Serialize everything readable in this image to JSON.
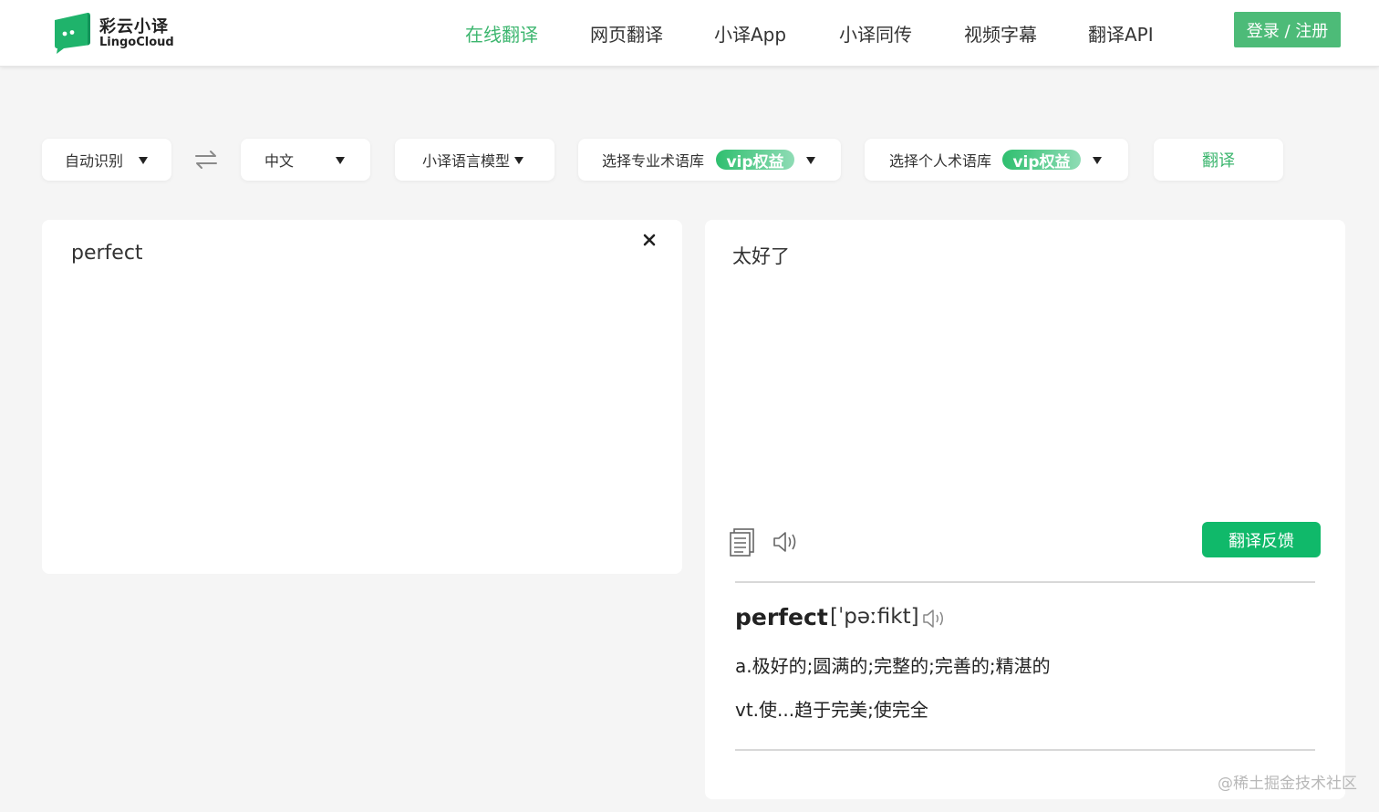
{
  "brand": {
    "title": "彩云小译",
    "subtitle": "LingoCloud",
    "accent": "#3db66f"
  },
  "nav": {
    "items": [
      {
        "label": "在线翻译",
        "active": true
      },
      {
        "label": "网页翻译",
        "active": false
      },
      {
        "label": "小译App",
        "active": false
      },
      {
        "label": "小译同传",
        "active": false
      },
      {
        "label": "视频字幕",
        "active": false
      },
      {
        "label": "翻译API",
        "active": false
      }
    ],
    "login_label": "登录 / 注册"
  },
  "toolbar": {
    "source_lang": "自动识别",
    "target_lang": "中文",
    "model": "小译语言模型",
    "pro_glossary": "选择专业术语库",
    "personal_glossary": "选择个人术语库",
    "vip_badge": "vip权益",
    "translate_label": "翻译"
  },
  "source": {
    "text": "perfect"
  },
  "target": {
    "text": "太好了",
    "feedback_label": "翻译反馈"
  },
  "dictionary": {
    "word": "perfect",
    "phonetic": "[ˈpəːfikt]",
    "definitions": [
      "a.极好的;圆满的;完整的;完善的;精湛的",
      "vt.使...趋于完美;使完全"
    ]
  },
  "watermark": "@稀土掘金技术社区"
}
